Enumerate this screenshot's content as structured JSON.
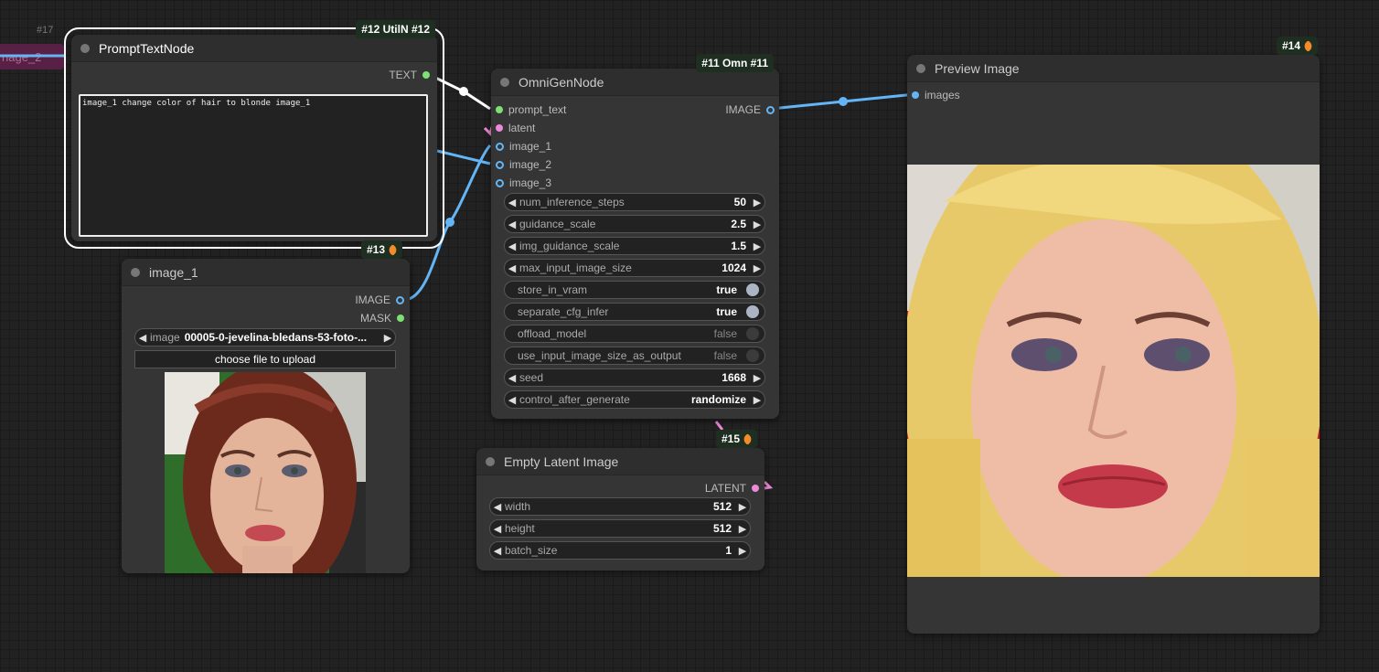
{
  "nodes": {
    "n12": {
      "badge": "#12 UtilN #12",
      "title": "PromptTextNode",
      "output": "TEXT",
      "text": "image_1 change color of hair to blonde image_1"
    },
    "n11": {
      "badge": "#11 Omn #11",
      "title": "OmniGenNode",
      "inputs": [
        "prompt_text",
        "latent",
        "image_1",
        "image_2",
        "image_3"
      ],
      "output": "IMAGE",
      "widgets": [
        {
          "label": "num_inference_steps",
          "value": "50"
        },
        {
          "label": "guidance_scale",
          "value": "2.5"
        },
        {
          "label": "img_guidance_scale",
          "value": "1.5"
        },
        {
          "label": "max_input_image_size",
          "value": "1024"
        }
      ],
      "toggles": [
        {
          "label": "store_in_vram",
          "value": "true",
          "on": true
        },
        {
          "label": "separate_cfg_infer",
          "value": "true",
          "on": true
        },
        {
          "label": "offload_model",
          "value": "false",
          "on": false
        },
        {
          "label": "use_input_image_size_as_output",
          "value": "false",
          "on": false
        }
      ],
      "seed": {
        "label": "seed",
        "value": "1668"
      },
      "control": {
        "label": "control_after_generate",
        "value": "randomize"
      }
    },
    "n13": {
      "badge": "#13",
      "title": "image_1",
      "outputs": [
        "IMAGE",
        "MASK"
      ],
      "image_widget": {
        "label": "image",
        "value": "00005-0-jevelina-bledans-53-foto-..."
      },
      "upload_label": "choose file to upload"
    },
    "n15": {
      "badge": "#15",
      "title": "Empty Latent Image",
      "output": "LATENT",
      "widgets": [
        {
          "label": "width",
          "value": "512"
        },
        {
          "label": "height",
          "value": "512"
        },
        {
          "label": "batch_size",
          "value": "1"
        }
      ]
    },
    "n14": {
      "badge": "#14",
      "title": "Preview Image",
      "input": "images"
    },
    "n17": {
      "id_label": "#17",
      "ghost_label": "nage_2"
    }
  },
  "colors": {
    "background": "#222222",
    "node": "#353535",
    "header": "#2e2e2e",
    "link_image": "#64b5f6",
    "link_text": "#ffffff",
    "link_latent": "#ec8ad7",
    "badge": "#1e2e21"
  },
  "icons": {
    "node_dot": "circle",
    "badge_icon": "fox-icon",
    "widget_left": "triangle-left",
    "widget_right": "triangle-right"
  }
}
